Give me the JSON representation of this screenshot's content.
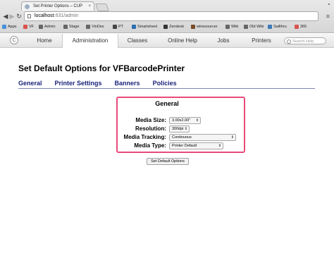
{
  "browser": {
    "tab_title": "Set Printer Options – CUP",
    "tab_close": "×",
    "url_host": "localhost",
    "url_path": ":631/admin",
    "back_icon": "◀",
    "forward_icon": "▶",
    "reload_icon": "↻",
    "menu_icon": "≡",
    "bookmarks": [
      {
        "label": "Apps",
        "color": "#4a8fd9"
      },
      {
        "label": "VF",
        "color": "#d9534f"
      },
      {
        "label": "Admin",
        "color": "#666666"
      },
      {
        "label": "Stage",
        "color": "#666666"
      },
      {
        "label": "VinDex",
        "color": "#666666"
      },
      {
        "label": "PT",
        "color": "#444444"
      },
      {
        "label": "Smartsheet",
        "color": "#2a6fb0"
      },
      {
        "label": "Zendesk",
        "color": "#333333"
      },
      {
        "label": "winesourcer",
        "color": "#7b4b2a"
      },
      {
        "label": "Wiki",
        "color": "#666666"
      },
      {
        "label": "Old Wiki",
        "color": "#666666"
      },
      {
        "label": "Sailthru",
        "color": "#3d7ab8"
      },
      {
        "label": "365",
        "color": "#d9534f"
      }
    ]
  },
  "cups_nav": {
    "logo_glyph": "C",
    "tabs": [
      "Home",
      "Administration",
      "Classes",
      "Online Help",
      "Jobs",
      "Printers"
    ],
    "active": "Administration",
    "search_placeholder": "Search Help"
  },
  "page": {
    "title": "Set Default Options for VFBarcodePrinter",
    "subtabs": [
      "General",
      "Printer Settings",
      "Banners",
      "Policies"
    ],
    "section_title": "General",
    "fields": [
      {
        "label": "Media Size:",
        "value": "3.00x2.00\""
      },
      {
        "label": "Resolution:",
        "value": "300dpi"
      },
      {
        "label": "Media Tracking:",
        "value": "Continuous"
      },
      {
        "label": "Media Type:",
        "value": "Printer Default"
      }
    ],
    "submit_label": "Set Default Options",
    "highlight_color": "#e84a7a"
  }
}
